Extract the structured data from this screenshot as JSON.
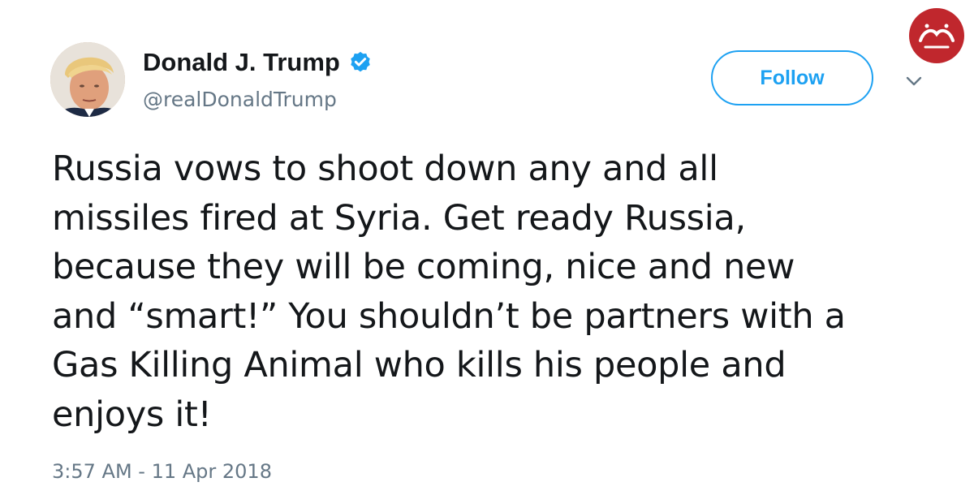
{
  "user": {
    "display_name": "Donald J. Trump",
    "handle": "@realDonaldTrump",
    "verified": true,
    "avatar_icon": "profile-photo"
  },
  "actions": {
    "follow_label": "Follow",
    "menu_icon": "chevron-down-icon"
  },
  "tweet": {
    "text": "Russia vows to shoot down any and all\nmissiles fired at Syria. Get ready Russia,\nbecause they will be coming, nice and new\nand “smart!” You shouldn’t be partners with a\nGas Killing Animal who kills his people and\nenjoys it!",
    "timestamp": "3:57 AM - 11 Apr 2018"
  },
  "watermark": {
    "text": "فرادید",
    "color": "#c0272d"
  },
  "colors": {
    "accent": "#1da1f2",
    "text": "#14171a",
    "muted": "#657786"
  }
}
